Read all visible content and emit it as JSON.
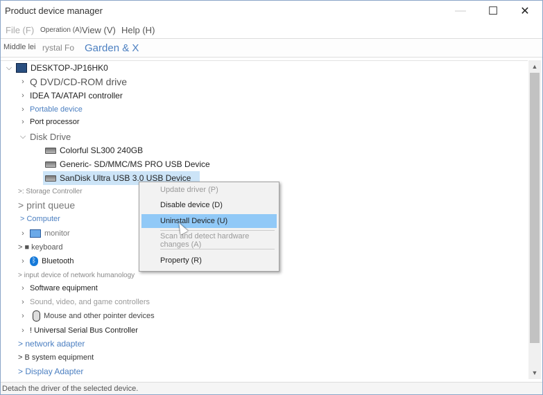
{
  "window": {
    "title": "Product device manager",
    "controls": {
      "minimize": "—",
      "maximize": "☐",
      "close": "✕"
    }
  },
  "menu": {
    "items": [
      {
        "label": "File (F)"
      },
      {
        "label": "Operation (A)"
      },
      {
        "label": "View (V)"
      },
      {
        "label": "Help (H)"
      }
    ]
  },
  "toolbar": {
    "left_text": "Middle lei",
    "mid_text": "rystal Fo",
    "link_text": "Garden & X"
  },
  "tree": {
    "root": "DESKTOP-JP16HK0",
    "items": [
      {
        "label": "Q DVD/CD-ROM drive"
      },
      {
        "label": "IDEA TA/ATAPI controller"
      },
      {
        "label": "Portable device"
      },
      {
        "label": "Port processor"
      },
      {
        "label": "Disk Drive"
      },
      {
        "label": "Colorful SL300 240GB"
      },
      {
        "label": "Generic- SD/MMC/MS PRO USB Device"
      },
      {
        "label": "SanDisk Ultra USB 3.0 USB Device"
      },
      {
        "label": ">: Storage Controller"
      },
      {
        "label": "> print queue"
      },
      {
        "label": "> Computer"
      },
      {
        "label": "monitor"
      },
      {
        "label": "> ■ keyboard"
      },
      {
        "label": "Bluetooth"
      },
      {
        "label": "> input device of network humanology"
      },
      {
        "label": "Software equipment"
      },
      {
        "label": "Sound, video, and game controllers"
      },
      {
        "label": "Mouse and other pointer devices"
      },
      {
        "label": "! Universal Serial Bus Controller"
      },
      {
        "label": "> network adapter"
      },
      {
        "label": "> B system equipment"
      },
      {
        "label": "> Display Adapter"
      }
    ]
  },
  "context_menu": {
    "items": [
      {
        "label": "Update driver (P)"
      },
      {
        "label": "Disable device (D)"
      },
      {
        "label": "Uninstall Device (U)"
      },
      {
        "label": "Scan and detect hardware changes (A)"
      },
      {
        "label": "Property (R)"
      }
    ]
  },
  "status": {
    "text": "Detach the driver of the selected device."
  },
  "colors": {
    "selection": "#cce4f7",
    "menu_highlight": "#91c9f7",
    "link": "#4b7fc1"
  }
}
